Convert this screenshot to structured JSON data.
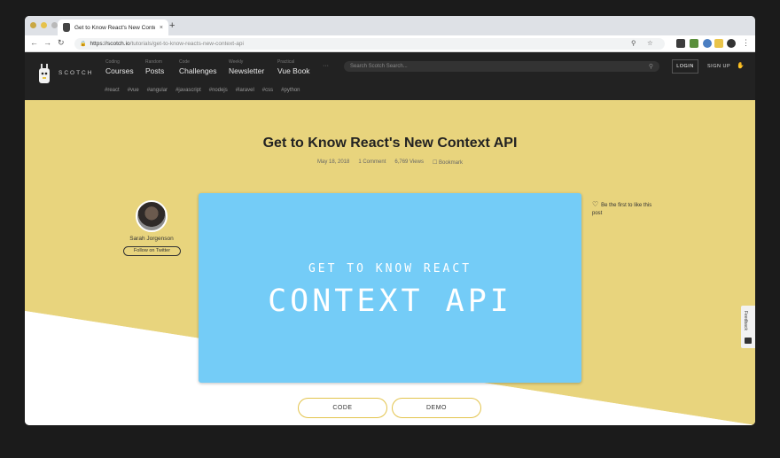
{
  "browser": {
    "tab_title": "Get to Know React's New Conte",
    "tab_close": "×",
    "new_tab": "+",
    "url_host": "https://scotch.io",
    "url_path": "/tutorials/get-to-know-reacts-new-context-api",
    "back": "←",
    "forward": "→",
    "reload": "↻",
    "lock": "🔒",
    "zoom": "⚲",
    "star": "☆",
    "kebab": "⋮"
  },
  "site": {
    "logo_text": "SCOTCH",
    "nav": [
      {
        "small": "Coding",
        "label": "Courses"
      },
      {
        "small": "Random",
        "label": "Posts"
      },
      {
        "small": "Code",
        "label": "Challenges"
      },
      {
        "small": "Weekly",
        "label": "Newsletter"
      },
      {
        "small": "Practical",
        "label": "Vue Book"
      }
    ],
    "more": "···",
    "search_placeholder": "Search Scotch Search...",
    "search_icon": "⚲",
    "login": "LOGIN",
    "signup": "SIGN UP",
    "signup_icon": "✋",
    "tags": [
      "#react",
      "#vue",
      "#angular",
      "#javascript",
      "#nodejs",
      "#laravel",
      "#css",
      "#python"
    ]
  },
  "article": {
    "title": "Get to Know React's New Context API",
    "date": "May 18, 2018",
    "comments": "1 Comment",
    "views": "6,769 Views",
    "bookmark_icon": "☐",
    "bookmark": "Bookmark",
    "author_name": "Sarah Jorgenson",
    "follow": "Follow on Twitter",
    "banner_sub": "GET TO KNOW REACT",
    "banner_main": "CONTEXT API",
    "like_icon": "♡",
    "like_text": "Be the first to like this post",
    "btn_code": "CODE",
    "btn_demo": "DEMO",
    "feedback": "Feedback"
  },
  "colors": {
    "hero_yellow": "#e8d47d",
    "banner_blue": "#74ccf7",
    "header_dark": "#222222",
    "button_border": "#e3c44e"
  }
}
